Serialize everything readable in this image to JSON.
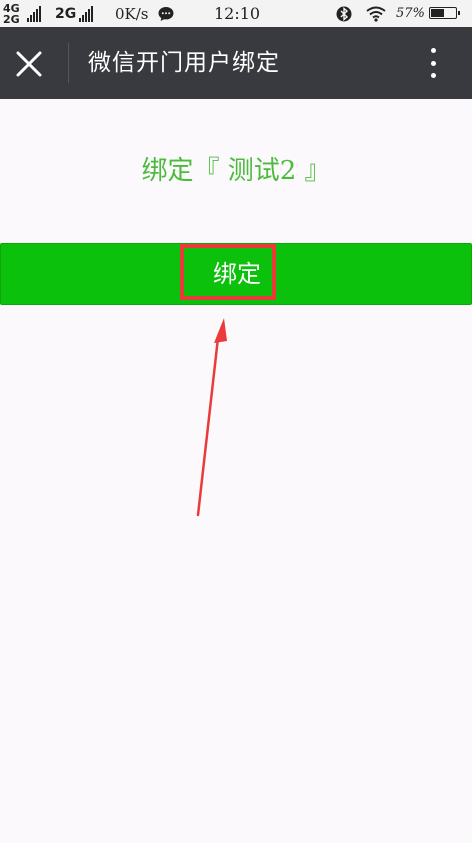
{
  "status_bar": {
    "net1": "4G",
    "net2": "2G",
    "net3": "2G",
    "speed": "0K/s",
    "time": "12:10",
    "battery_pct": "57%",
    "battery_level": 0.57,
    "icons": [
      "signal-icon",
      "chat-notification-icon",
      "bluetooth-icon",
      "wifi-icon",
      "battery-icon"
    ]
  },
  "titlebar": {
    "title": "微信开门用户绑定",
    "close_icon": "close-icon",
    "more_icon": "more-vertical-icon"
  },
  "main": {
    "heading": "绑定『 测试2 』",
    "bind_button_label": "绑定"
  },
  "colors": {
    "titlebar_bg": "#393a3f",
    "accent_green": "#0bc10b",
    "heading_green": "#4cbb3c",
    "annotation_red": "#ea3a3a"
  }
}
